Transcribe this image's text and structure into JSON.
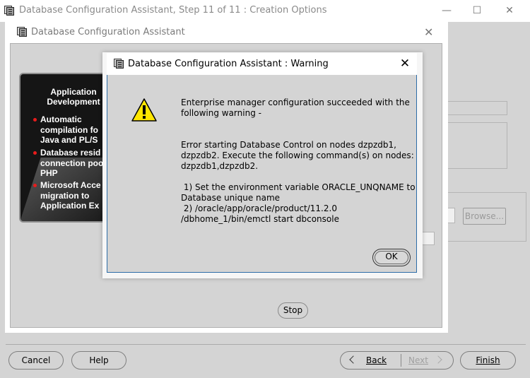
{
  "main_window": {
    "title": "Database Configuration Assistant, Step 11 of 11 : Creation Options",
    "minimize": "—",
    "maximize": "☐",
    "close": "✕"
  },
  "inner_window": {
    "title": "Database Configuration Assistant",
    "close": "✕"
  },
  "marketing": {
    "heading_line1": "Application",
    "heading_line2": "Development",
    "items": [
      {
        "lines": [
          "Automatic",
          "compilation fo",
          "Java and PL/S"
        ]
      },
      {
        "lines": [
          "Database resid",
          "connection poo",
          "PHP"
        ]
      },
      {
        "lines": [
          "Microsoft Acce",
          "migration to",
          "Application Ex"
        ]
      }
    ]
  },
  "background_buttons": {
    "browse": "Browse...",
    "stop": "Stop"
  },
  "footer": {
    "cancel": "Cancel",
    "help": "Help",
    "back": "Back",
    "next": "Next",
    "finish": "Finish"
  },
  "dialog": {
    "title": "Database Configuration Assistant : Warning",
    "close": "✕",
    "message": [
      "Enterprise manager configuration succeeded with the",
      "following warning -",
      "Error starting Database Control on nodes dzpzdb1,",
      "dzpzdb2. Execute the following command(s) on nodes:",
      "dzpzdb1,dzpzdb2.",
      " 1) Set the environment variable ORACLE_UNQNAME to",
      "Database unique name",
      " 2) /oracle/app/oracle/product/11.2.0",
      "/dbhome_1/bin/emctl start dbconsole"
    ],
    "ok": "OK"
  }
}
